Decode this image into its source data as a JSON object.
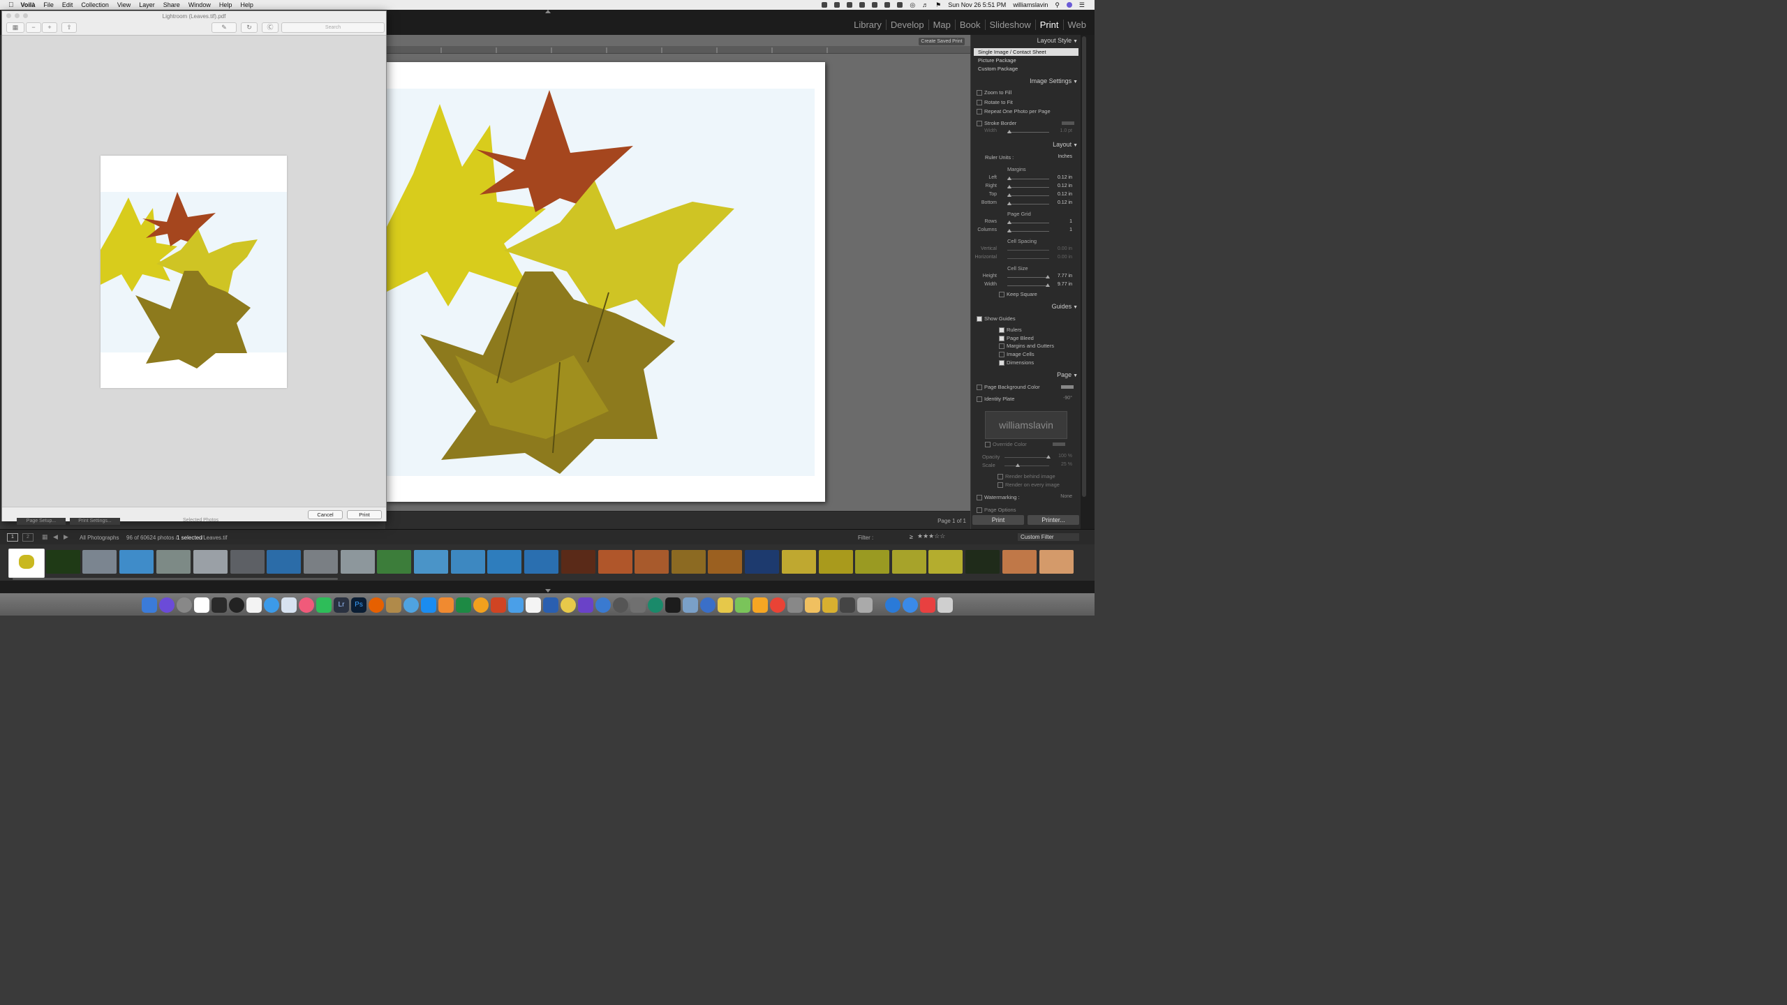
{
  "menubar": {
    "app": "Voilà",
    "items": [
      "File",
      "Edit",
      "Collection",
      "View",
      "Layer",
      "Share",
      "Window",
      "Help",
      "Help"
    ],
    "clock": "Sun Nov 26  5:51 PM",
    "user": "williamslavin"
  },
  "modules": [
    "Library",
    "Develop",
    "Map",
    "Book",
    "Slideshow",
    "Print",
    "Web"
  ],
  "active_module": "Print",
  "toolbar": {
    "create_saved_print": "Create Saved Print",
    "page_of": "Page 1 of 1"
  },
  "right_panel": {
    "layout_style": {
      "title": "Layout Style",
      "options": [
        "Single Image / Contact Sheet",
        "Picture Package",
        "Custom Package"
      ],
      "selected": "Single Image / Contact Sheet"
    },
    "image_settings": {
      "title": "Image Settings",
      "zoom_to_fill": "Zoom to Fill",
      "rotate_to_fit": "Rotate to Fit",
      "repeat_one": "Repeat One Photo per Page",
      "stroke_border": "Stroke Border",
      "width_label": "Width",
      "width_value": "1.0 pt"
    },
    "layout": {
      "title": "Layout",
      "ruler_units_label": "Ruler Units :",
      "ruler_units_value": "Inches",
      "margins_title": "Margins",
      "left_label": "Left",
      "left_value": "0.12 in",
      "right_label": "Right",
      "right_value": "0.12 in",
      "top_label": "Top",
      "top_value": "0.12 in",
      "bottom_label": "Bottom",
      "bottom_value": "0.12 in",
      "page_grid_title": "Page Grid",
      "rows_label": "Rows",
      "rows_value": "1",
      "columns_label": "Columns",
      "columns_value": "1",
      "cell_spacing_title": "Cell Spacing",
      "vertical_label": "Vertical",
      "vertical_value": "0.00 in",
      "horizontal_label": "Horizontal",
      "horizontal_value": "0.00 in",
      "cell_size_title": "Cell Size",
      "height_label": "Height",
      "height_value": "7.77 in",
      "width_label": "Width",
      "width_value": "9.77 in",
      "keep_square": "Keep Square"
    },
    "guides": {
      "title": "Guides",
      "show_guides": "Show Guides",
      "rulers": "Rulers",
      "page_bleed": "Page Bleed",
      "margins_gutters": "Margins and Gutters",
      "image_cells": "Image Cells",
      "dimensions": "Dimensions"
    },
    "page": {
      "title": "Page",
      "bg_color": "Page Background Color",
      "identity_plate": "Identity Plate",
      "identity_angle": "-90°",
      "identity_text": "williamslavin",
      "override_color": "Override Color",
      "opacity_label": "Opacity",
      "opacity_value": "100 %",
      "scale_label": "Scale",
      "scale_value": "25 %",
      "render_behind": "Render behind image",
      "render_every": "Render on every image",
      "watermarking": "Watermarking :",
      "watermarking_value": "None",
      "page_options": "Page Options"
    },
    "print_button": "Print",
    "printer_button": "Printer..."
  },
  "left_bottom": {
    "page_setup": "Page Setup...",
    "print_settings": "Print Settings...",
    "selected_photos": "Selected Photos"
  },
  "filmstrip": {
    "page1": "1",
    "page2": "2",
    "source": "All Photographs",
    "count_text": "96 of 60624 photos /",
    "selected_text": "1 selected",
    "file_text": "/Leaves.tif",
    "filter_label": "Filter :",
    "filter_value": "Custom Filter",
    "rating_op": "≥"
  },
  "preview": {
    "title": "Lightroom (Leaves.tif).pdf",
    "search_placeholder": "Search",
    "cancel": "Cancel",
    "print": "Print"
  },
  "colors": {
    "lr_bg": "#3a3a3a",
    "panel": "#2a2a2a",
    "paper": "#ffffff",
    "menubar": "#ececec"
  }
}
